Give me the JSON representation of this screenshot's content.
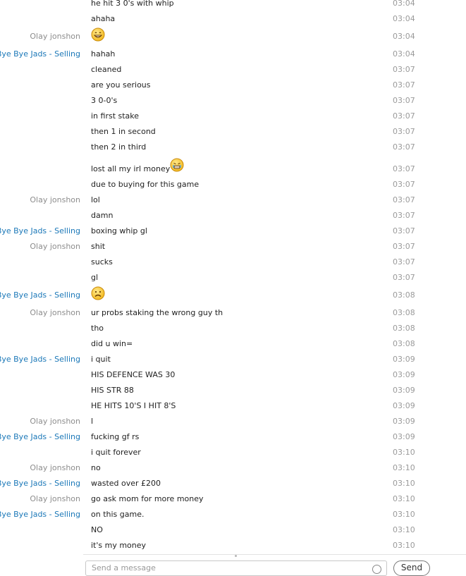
{
  "messages": [
    {
      "sender": "",
      "text": "he hit 3 0's with whip",
      "time": "03:04"
    },
    {
      "sender": "",
      "text": "ahaha",
      "time": "03:04"
    },
    {
      "sender": "Olay jonshon",
      "text": "",
      "emoji": "grin-emoji",
      "time": "03:04"
    },
    {
      "sender": "Bye Bye Jads - Selling",
      "text": "hahah",
      "time": "03:04"
    },
    {
      "sender": "",
      "text": "cleaned",
      "time": "03:07"
    },
    {
      "sender": "",
      "text": "are you serious",
      "time": "03:07"
    },
    {
      "sender": "",
      "text": "3 0-0's",
      "time": "03:07"
    },
    {
      "sender": "",
      "text": "in first stake",
      "time": "03:07"
    },
    {
      "sender": "",
      "text": "then 1 in second",
      "time": "03:07"
    },
    {
      "sender": "",
      "text": "then 2 in third",
      "time": "03:07"
    },
    {
      "sender": "",
      "text": "lost all my irl money",
      "emoji": "crying-emoji",
      "time": "03:07"
    },
    {
      "sender": "",
      "text": "due to buying for this game",
      "time": "03:07"
    },
    {
      "sender": "Olay jonshon",
      "text": "lol",
      "time": "03:07"
    },
    {
      "sender": "",
      "text": "damn",
      "time": "03:07"
    },
    {
      "sender": "Bye Bye Jads - Selling",
      "text": "boxing whip gl",
      "time": "03:07"
    },
    {
      "sender": "Olay jonshon",
      "text": "shit",
      "time": "03:07"
    },
    {
      "sender": "",
      "text": "sucks",
      "time": "03:07"
    },
    {
      "sender": "",
      "text": "gl",
      "time": "03:07"
    },
    {
      "sender": "Bye Bye Jads - Selling",
      "text": "",
      "emoji": "sad-emoji",
      "time": "03:08"
    },
    {
      "sender": "Olay jonshon",
      "text": "ur probs staking the wrong guy th",
      "time": "03:08"
    },
    {
      "sender": "",
      "text": "tho",
      "time": "03:08"
    },
    {
      "sender": "",
      "text": "did u win=",
      "time": "03:08"
    },
    {
      "sender": "Bye Bye Jads - Selling",
      "text": "i quit",
      "time": "03:09"
    },
    {
      "sender": "",
      "text": "HIS DEFENCE WAS 30",
      "time": "03:09"
    },
    {
      "sender": "",
      "text": "HIS STR 88",
      "time": "03:09"
    },
    {
      "sender": "",
      "text": "HE HITS 10'S I HIT 8'S",
      "time": "03:09"
    },
    {
      "sender": "Olay jonshon",
      "text": "l",
      "time": "03:09"
    },
    {
      "sender": "Bye Bye Jads - Selling",
      "text": "fucking gf rs",
      "time": "03:09"
    },
    {
      "sender": "",
      "text": "i quit forever",
      "time": "03:10"
    },
    {
      "sender": "Olay jonshon",
      "text": "no",
      "time": "03:10"
    },
    {
      "sender": "Bye Bye Jads - Selling",
      "text": "wasted over £200",
      "time": "03:10"
    },
    {
      "sender": "Olay jonshon",
      "text": "go ask mom for more money",
      "time": "03:10"
    },
    {
      "sender": "Bye Bye Jads - Selling",
      "text": "on this game.",
      "time": "03:10"
    },
    {
      "sender": "",
      "text": "NO",
      "time": "03:10"
    },
    {
      "sender": "",
      "text": "it's my money",
      "time": "03:10"
    }
  ],
  "composer": {
    "placeholder": "Send a message",
    "send_label": "Send"
  },
  "colors": {
    "self_sender": "#1b78b8",
    "other_sender": "#8d8d8d",
    "timestamp": "#9a9a9a"
  }
}
